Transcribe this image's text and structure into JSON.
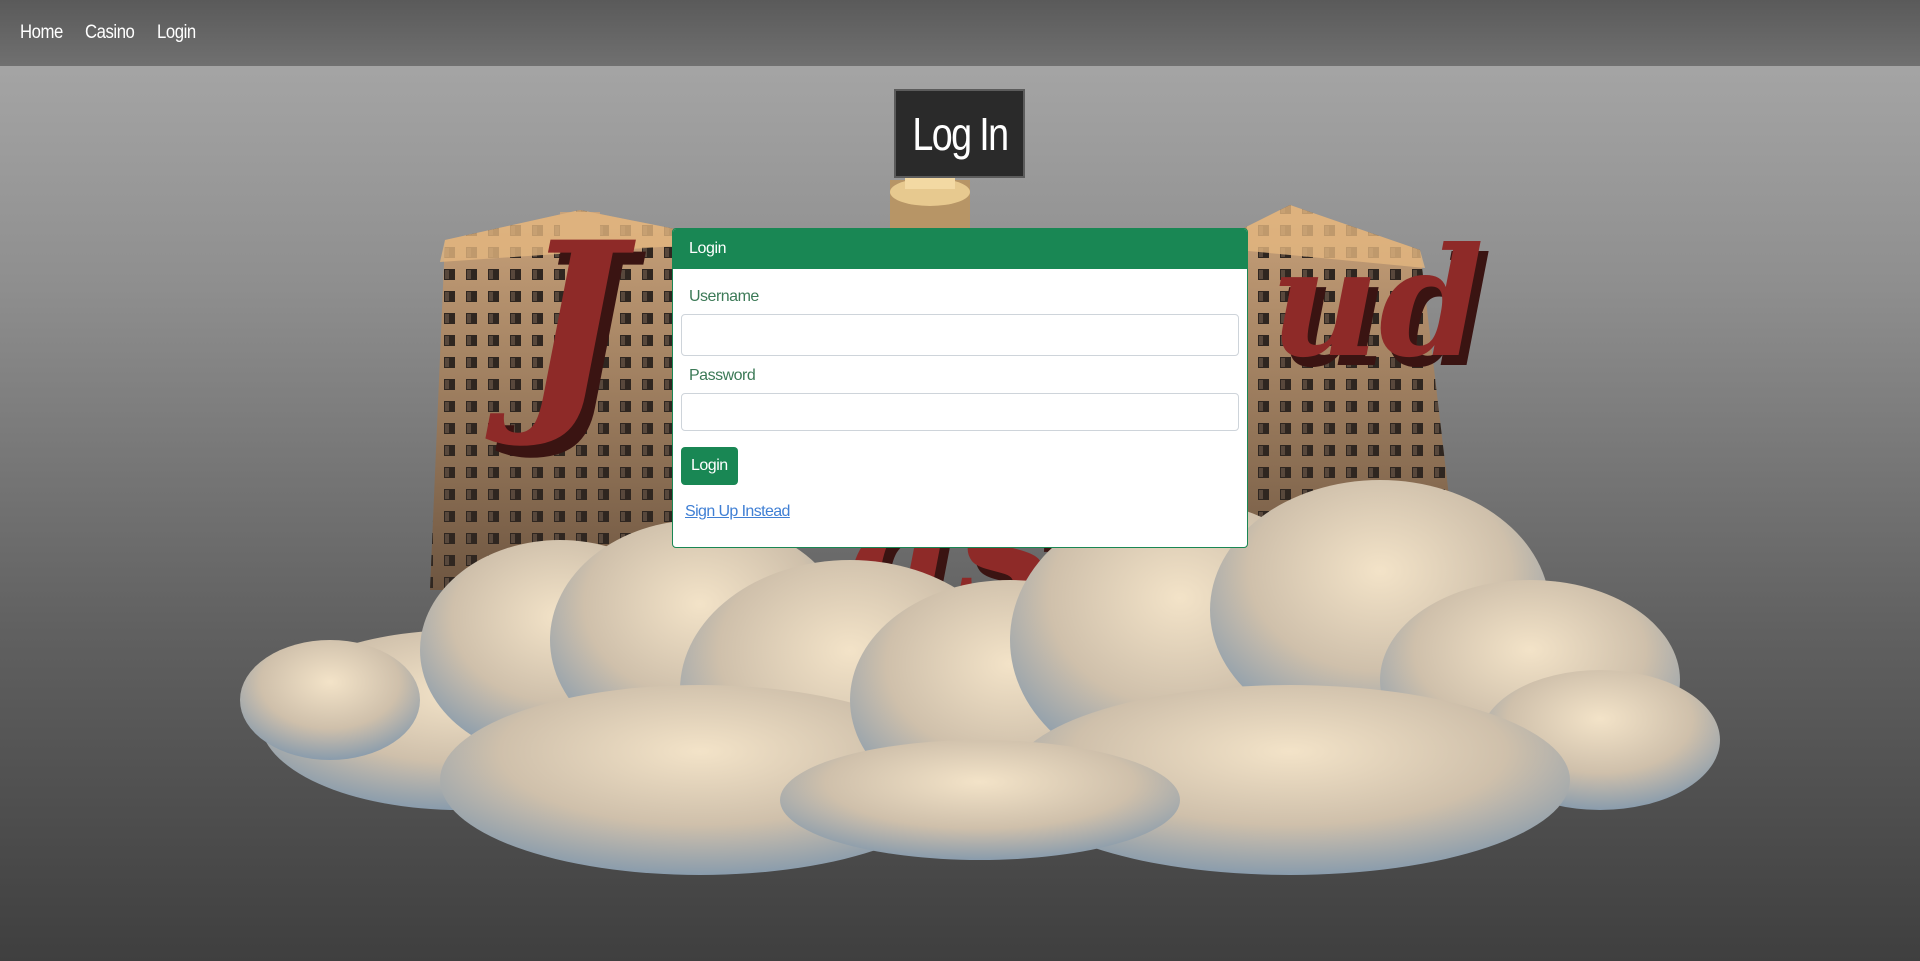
{
  "nav": {
    "items": [
      {
        "label": "Home"
      },
      {
        "label": "Casino"
      },
      {
        "label": "Login"
      }
    ]
  },
  "page": {
    "heading": "Log In"
  },
  "login_card": {
    "header": "Login",
    "username_label": "Username",
    "username_value": "",
    "password_label": "Password",
    "password_value": "",
    "submit_label": "Login",
    "signup_link": "Sign Up Instead"
  },
  "hero": {
    "logo_text": [
      "Cloud",
      "Casino"
    ]
  },
  "colors": {
    "accent": "#198754",
    "link": "#3f7fd4",
    "logo_red": "#8e2a28",
    "heading_bg": "#2a2a2a"
  }
}
